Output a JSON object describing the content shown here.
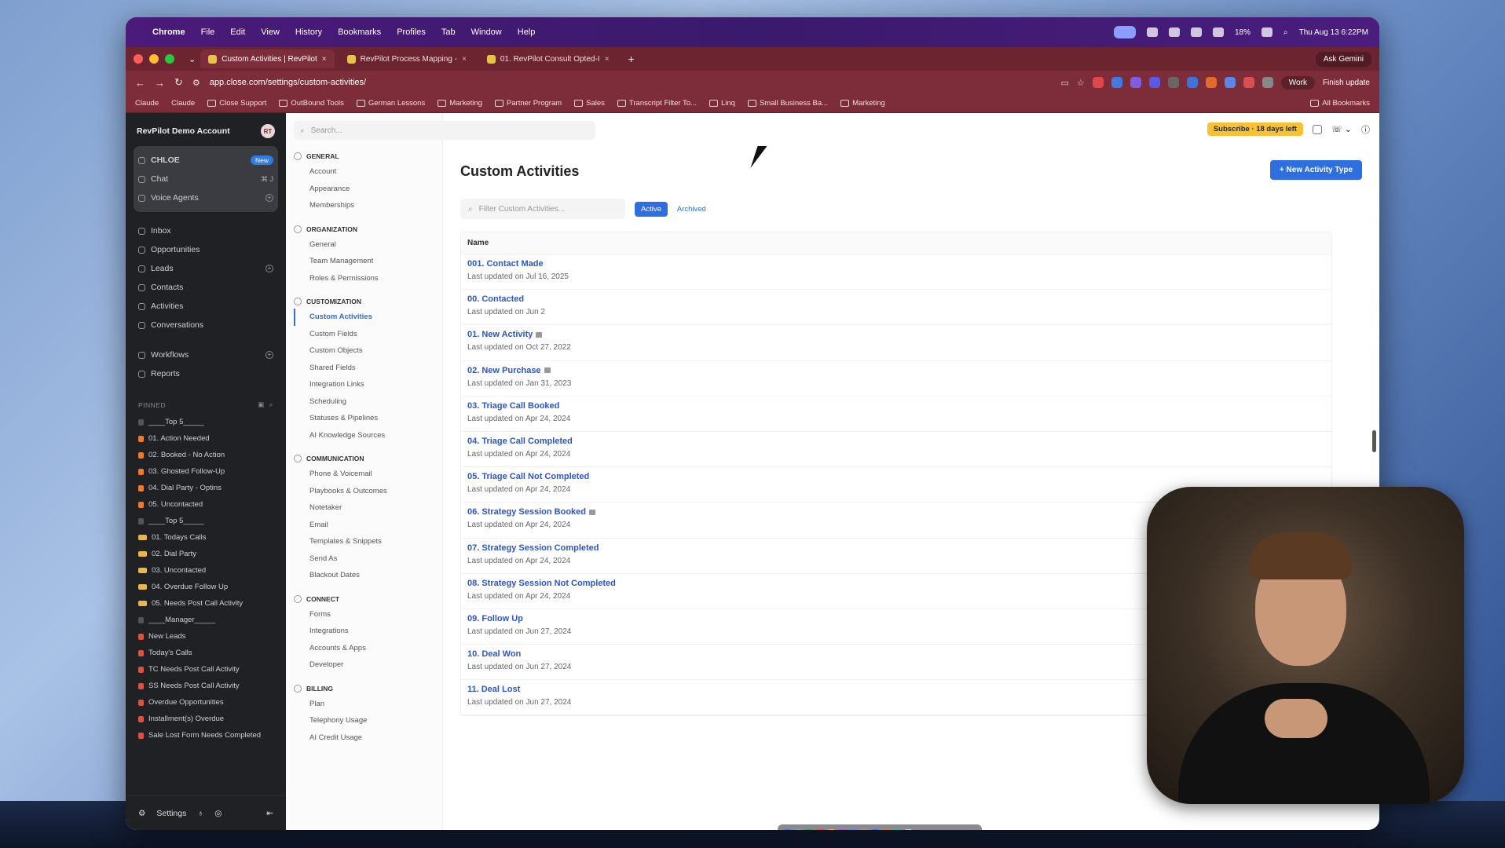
{
  "menubar": {
    "app": "Chrome",
    "items": [
      "File",
      "Edit",
      "View",
      "History",
      "Bookmarks",
      "Profiles",
      "Tab",
      "Window",
      "Help"
    ],
    "battery": "18%",
    "clock": "Thu Aug 13 6:22PM"
  },
  "tabs": [
    {
      "label": "Custom Activities | RevPilot",
      "active": true
    },
    {
      "label": "RevPilot Process Mapping -",
      "active": false
    },
    {
      "label": "01. RevPilot Consult Opted-I",
      "active": false
    }
  ],
  "ask_gemini": "Ask Gemini",
  "address": {
    "url": "app.close.com/settings/custom-activities/",
    "profile": "Work",
    "finish_update": "Finish update"
  },
  "bookmarks": [
    "Claude",
    "Claude",
    "Close Support",
    "OutBound Tools",
    "German Lessons",
    "Marketing",
    "Partner Program",
    "Sales",
    "Transcript Filter To...",
    "Linq",
    "Small Business Ba...",
    "Marketing"
  ],
  "all_bookmarks": "All Bookmarks",
  "sidebar": {
    "account": "RevPilot Demo Account",
    "avatar": "RT",
    "chloe": [
      {
        "label": "CHLOE",
        "badge": "New"
      },
      {
        "label": "Chat",
        "shortcut": "⌘ J"
      },
      {
        "label": "Voice Agents"
      }
    ],
    "nav": [
      "Inbox",
      "Opportunities",
      "Leads",
      "Contacts",
      "Activities",
      "Conversations"
    ],
    "nav2": [
      "Workflows",
      "Reports"
    ],
    "pinned_label": "PINNED",
    "pinned": [
      {
        "label": "____Top 5_____",
        "icon": "g"
      },
      {
        "label": "01. Action Needed",
        "icon": "f"
      },
      {
        "label": "02. Booked - No Action",
        "icon": "f"
      },
      {
        "label": "03. Ghosted Follow-Up",
        "icon": "f"
      },
      {
        "label": "04. Dial Party - Optins",
        "icon": "f"
      },
      {
        "label": "05. Uncontacted",
        "icon": "f"
      },
      {
        "label": "____Top 5_____",
        "icon": "g"
      },
      {
        "label": "01. Todays Calls",
        "icon": "m"
      },
      {
        "label": "02. Dial Party",
        "icon": "m"
      },
      {
        "label": "03. Uncontacted",
        "icon": "m"
      },
      {
        "label": "04. Overdue Follow Up",
        "icon": "m"
      },
      {
        "label": "05. Needs Post Call Activity",
        "icon": "m"
      },
      {
        "label": "____Manager_____",
        "icon": "g"
      },
      {
        "label": "New Leads",
        "icon": "r"
      },
      {
        "label": "Today's Calls",
        "icon": "r"
      },
      {
        "label": "TC Needs Post Call Activity",
        "icon": "r"
      },
      {
        "label": "SS Needs Post Call Activity",
        "icon": "r"
      },
      {
        "label": "Overdue Opportunities",
        "icon": "r"
      },
      {
        "label": "Installment(s) Overdue",
        "icon": "r"
      },
      {
        "label": "Sale Lost Form Needs Completed",
        "icon": "r"
      }
    ],
    "settings": "Settings"
  },
  "settings_nav": {
    "search_placeholder": "Search...",
    "sections": [
      {
        "title": "GENERAL",
        "items": [
          "Account",
          "Appearance",
          "Memberships"
        ]
      },
      {
        "title": "ORGANIZATION",
        "items": [
          "General",
          "Team Management",
          "Roles & Permissions"
        ]
      },
      {
        "title": "CUSTOMIZATION",
        "items": [
          "Custom Activities",
          "Custom Fields",
          "Custom Objects",
          "Shared Fields",
          "Integration Links",
          "Scheduling",
          "Statuses & Pipelines",
          "AI Knowledge Sources"
        ]
      },
      {
        "title": "COMMUNICATION",
        "items": [
          "Phone & Voicemail",
          "Playbooks & Outcomes",
          "Notetaker",
          "Email",
          "Templates & Snippets",
          "Send As",
          "Blackout Dates"
        ]
      },
      {
        "title": "CONNECT",
        "items": [
          "Forms",
          "Integrations",
          "Accounts & Apps",
          "Developer"
        ]
      },
      {
        "title": "BILLING",
        "items": [
          "Plan",
          "Telephony Usage",
          "AI Credit Usage"
        ]
      }
    ],
    "selected": "Custom Activities"
  },
  "main": {
    "subscribe": "Subscribe · 18 days left",
    "title": "Custom Activities",
    "new_button": "New Activity Type",
    "filter_placeholder": "Filter Custom Activities...",
    "active_tab": "Active",
    "archived_tab": "Archived",
    "column": "Name",
    "rows": [
      {
        "name": "001. Contact Made",
        "updated": "Last updated on Jul 16, 2025",
        "locked": false
      },
      {
        "name": "00. Contacted",
        "updated": "Last updated on Jun 2",
        "locked": false
      },
      {
        "name": "01. New Activity",
        "updated": "Last updated on Oct 27, 2022",
        "locked": true
      },
      {
        "name": "02. New Purchase",
        "updated": "Last updated on Jan 31, 2023",
        "locked": true
      },
      {
        "name": "03. Triage Call Booked",
        "updated": "Last updated on Apr 24, 2024",
        "locked": false
      },
      {
        "name": "04. Triage Call Completed",
        "updated": "Last updated on Apr 24, 2024",
        "locked": false
      },
      {
        "name": "05. Triage Call Not Completed",
        "updated": "Last updated on Apr 24, 2024",
        "locked": false
      },
      {
        "name": "06. Strategy Session Booked",
        "updated": "Last updated on Apr 24, 2024",
        "locked": true
      },
      {
        "name": "07. Strategy Session Completed",
        "updated": "Last updated on Apr 24, 2024",
        "locked": false
      },
      {
        "name": "08. Strategy Session Not Completed",
        "updated": "Last updated on Apr 24, 2024",
        "locked": false
      },
      {
        "name": "09. Follow Up",
        "updated": "Last updated on Jun 27, 2024",
        "locked": false
      },
      {
        "name": "10. Deal Won",
        "updated": "Last updated on Jun 27, 2024",
        "locked": false
      },
      {
        "name": "11. Deal Lost",
        "updated": "Last updated on Jun 27, 2024",
        "locked": false
      }
    ]
  },
  "colors": {
    "accent": "#2d6fe0",
    "tab_bar": "#7c2d39",
    "sidebar": "#1f2125",
    "subscribe": "#f6c233"
  }
}
